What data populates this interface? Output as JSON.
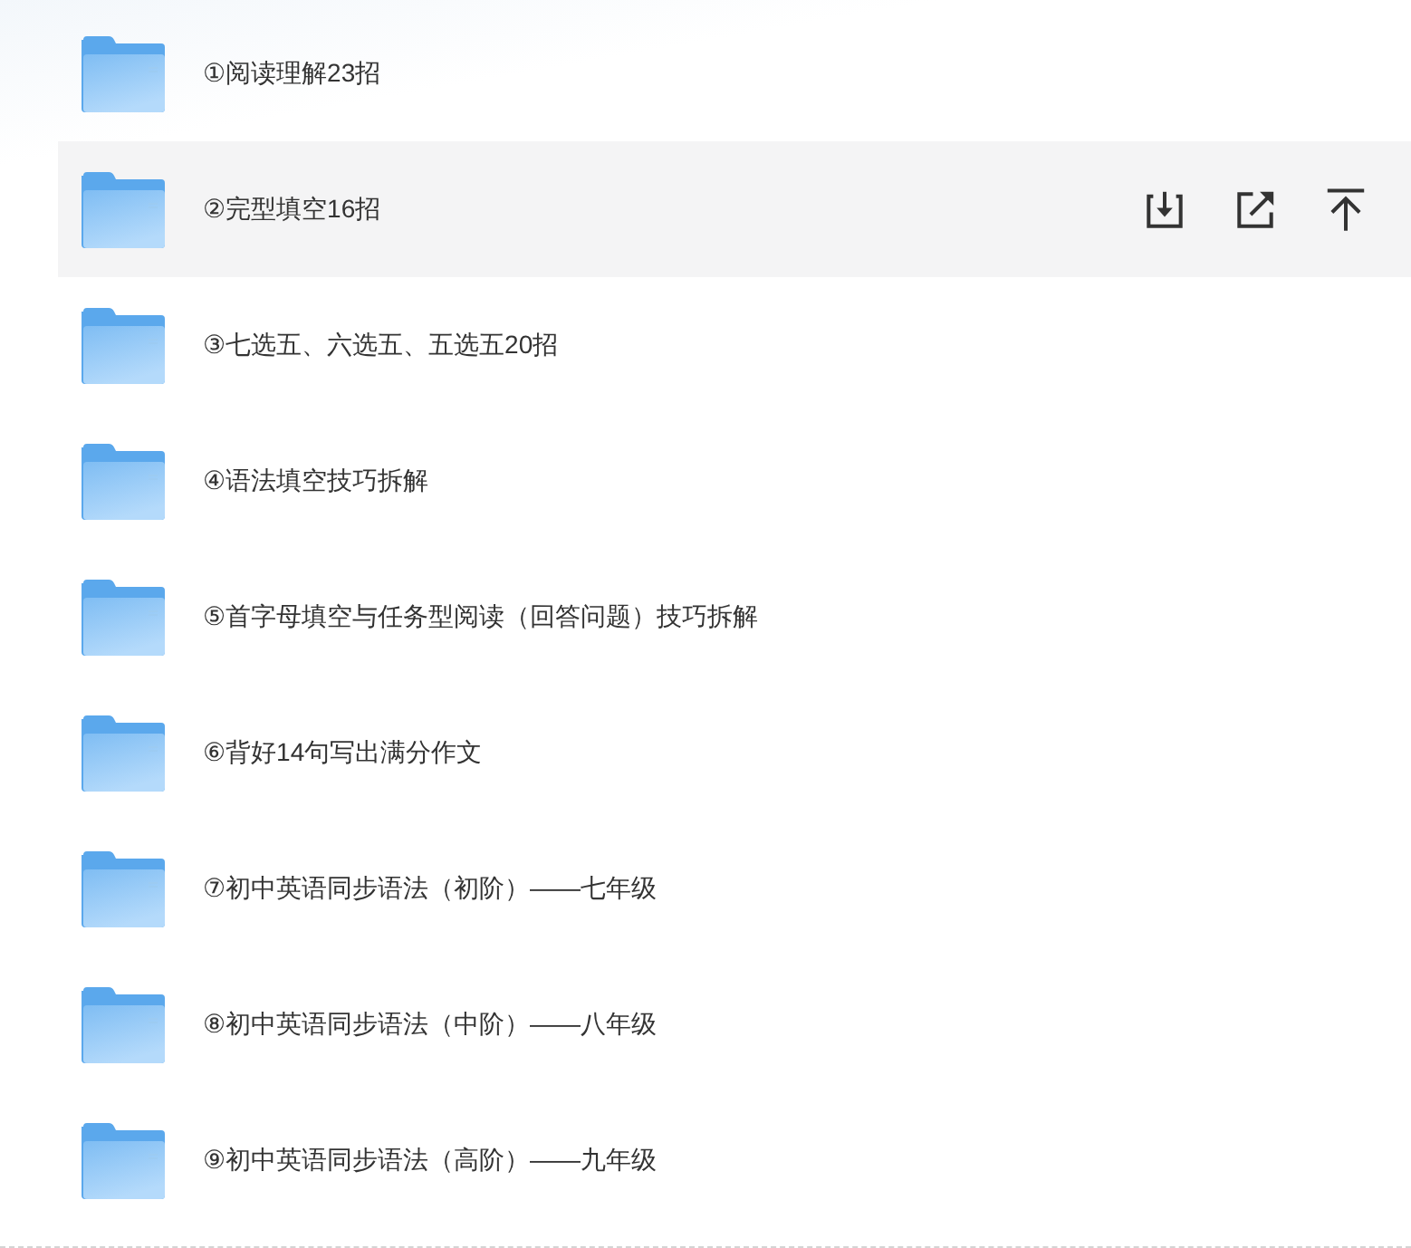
{
  "folders": [
    {
      "name": "①阅读理解23招",
      "selected": false
    },
    {
      "name": "②完型填空16招",
      "selected": true
    },
    {
      "name": "③七选五、六选五、五选五20招",
      "selected": false
    },
    {
      "name": "④语法填空技巧拆解",
      "selected": false
    },
    {
      "name": "⑤首字母填空与任务型阅读（回答问题）技巧拆解",
      "selected": false
    },
    {
      "name": "⑥背好14句写出满分作文",
      "selected": false
    },
    {
      "name": "⑦初中英语同步语法（初阶）——七年级",
      "selected": false
    },
    {
      "name": "⑧初中英语同步语法（中阶）——八年级",
      "selected": false
    },
    {
      "name": "⑨初中英语同步语法（高阶）——九年级",
      "selected": false
    }
  ]
}
